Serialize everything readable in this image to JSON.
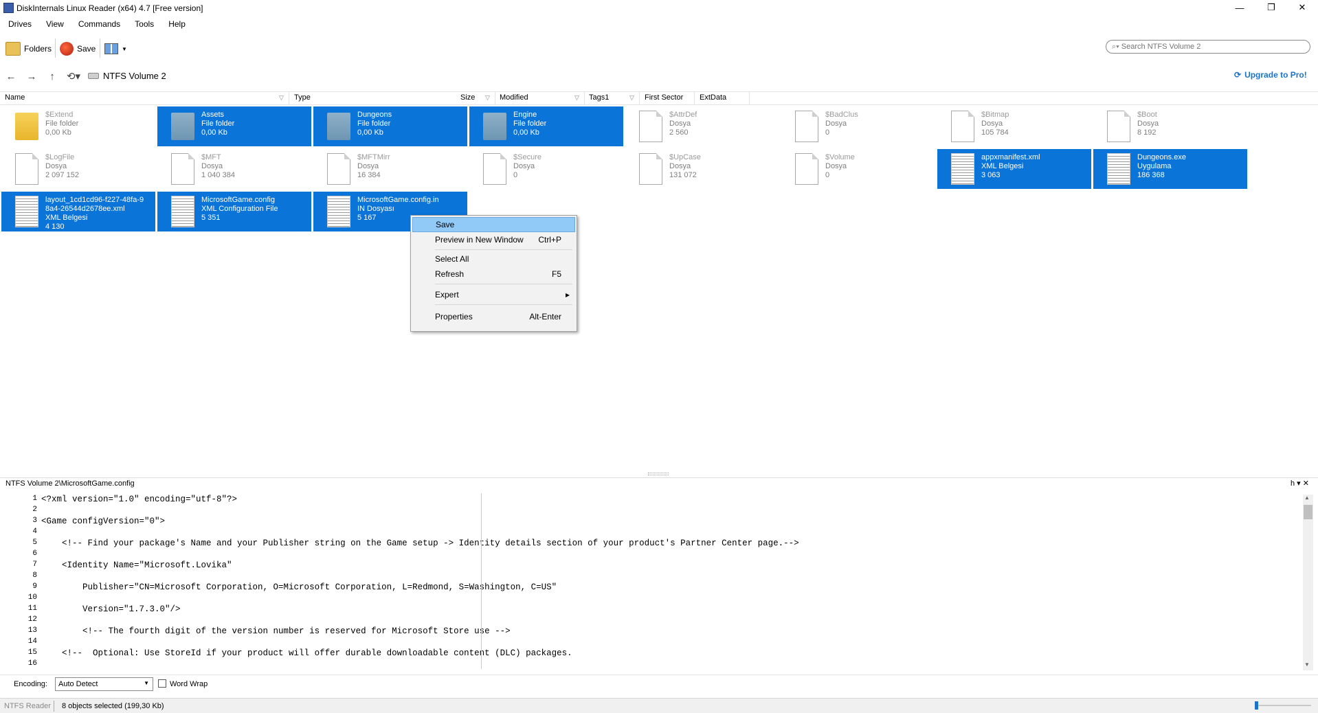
{
  "window": {
    "title": "DiskInternals Linux Reader (x64) 4.7 [Free version]",
    "minimize": "—",
    "maximize": "❐",
    "close": "✕"
  },
  "menu": [
    "Drives",
    "View",
    "Commands",
    "Tools",
    "Help"
  ],
  "toolbar": {
    "folders_label": "Folders",
    "save_label": "Save"
  },
  "search": {
    "placeholder": "Search NTFS Volume 2"
  },
  "nav": {
    "path": "NTFS Volume 2",
    "upgrade": "Upgrade to Pro!"
  },
  "columns": [
    "Name",
    "Type",
    "Size",
    "Modified",
    "Tags1",
    "First Sector",
    "ExtData"
  ],
  "files": [
    {
      "name": "$Extend",
      "type": "File folder",
      "size": "0,00 Kb",
      "icon": "folder",
      "selected": false
    },
    {
      "name": "Assets",
      "type": "File folder",
      "size": "0,00 Kb",
      "icon": "folder",
      "selected": true
    },
    {
      "name": "Dungeons",
      "type": "File folder",
      "size": "0,00 Kb",
      "icon": "folder",
      "selected": true
    },
    {
      "name": "Engine",
      "type": "File folder",
      "size": "0,00 Kb",
      "icon": "folder",
      "selected": true
    },
    {
      "name": "$AttrDef",
      "type": "Dosya",
      "size": "2 560",
      "icon": "doc",
      "selected": false
    },
    {
      "name": "$BadClus",
      "type": "Dosya",
      "size": "0",
      "icon": "doc",
      "selected": false
    },
    {
      "name": "$Bitmap",
      "type": "Dosya",
      "size": "105 784",
      "icon": "doc",
      "selected": false
    },
    {
      "name": "$Boot",
      "type": "Dosya",
      "size": "8 192",
      "icon": "doc",
      "selected": false
    },
    {
      "name": "$LogFile",
      "type": "Dosya",
      "size": "2 097 152",
      "icon": "doc",
      "selected": false
    },
    {
      "name": "$MFT",
      "type": "Dosya",
      "size": "1 040 384",
      "icon": "doc",
      "selected": false
    },
    {
      "name": "$MFTMirr",
      "type": "Dosya",
      "size": "16 384",
      "icon": "doc",
      "selected": false
    },
    {
      "name": "$Secure",
      "type": "Dosya",
      "size": "0",
      "icon": "doc",
      "selected": false
    },
    {
      "name": "$UpCase",
      "type": "Dosya",
      "size": "131 072",
      "icon": "doc",
      "selected": false
    },
    {
      "name": "$Volume",
      "type": "Dosya",
      "size": "0",
      "icon": "doc",
      "selected": false
    },
    {
      "name": "appxmanifest.xml",
      "type": "XML Belgesi",
      "size": "3 063",
      "icon": "thumb",
      "selected": true
    },
    {
      "name": "Dungeons.exe",
      "type": "Uygulama",
      "size": "186 368",
      "icon": "thumb",
      "selected": true
    },
    {
      "name": "layout_1cd1cd96-f227-48fa-98a4-26544d2678ee.xml",
      "name_line1": "layout_1cd1cd96-f227-48fa-9",
      "name_line2": "8a4-26544d2678ee.xml",
      "type": "XML Belgesi",
      "size": "4 130",
      "icon": "thumb",
      "selected": true
    },
    {
      "name": "MicrosoftGame.config",
      "type": "XML Configuration File",
      "size": "5 351",
      "icon": "thumb",
      "selected": true
    },
    {
      "name": "MicrosoftGame.config.in",
      "type": "IN Dosyası",
      "size": "5 167",
      "icon": "thumb",
      "selected": true
    }
  ],
  "context_menu": [
    {
      "label": "Save",
      "shortcut": ""
    },
    {
      "label": "Preview in New Window",
      "shortcut": "Ctrl+P"
    },
    {
      "label": "Select All",
      "shortcut": ""
    },
    {
      "label": "Refresh",
      "shortcut": "F5"
    },
    {
      "label": "Expert",
      "shortcut": "▸"
    },
    {
      "label": "Properties",
      "shortcut": "Alt-Enter"
    }
  ],
  "preview": {
    "path": "NTFS Volume 2\\MicrosoftGame.config",
    "panel_controls": "h ▾ ✕",
    "lines": [
      "<?xml version=\"1.0\" encoding=\"utf-8\"?>",
      "",
      "<Game configVersion=\"0\">",
      "",
      "    <!-- Find your package's Name and your Publisher string on the Game setup -> Identity details section of your product's Partner Center page.-->",
      "",
      "    <Identity Name=\"Microsoft.Lovika\"",
      "",
      "        Publisher=\"CN=Microsoft Corporation, O=Microsoft Corporation, L=Redmond, S=Washington, C=US\"",
      "",
      "        Version=\"1.7.3.0\"/>",
      "",
      "        <!-- The fourth digit of the version number is reserved for Microsoft Store use -->",
      "",
      "    <!--  Optional: Use StoreId if your product will offer durable downloadable content (DLC) packages.",
      ""
    ],
    "encoding_label": "Encoding:",
    "encoding_value": "Auto Detect",
    "word_wrap": "Word Wrap"
  },
  "status": {
    "app": "NTFS Reader",
    "selection": "8 objects selected (199,30 Kb)"
  }
}
